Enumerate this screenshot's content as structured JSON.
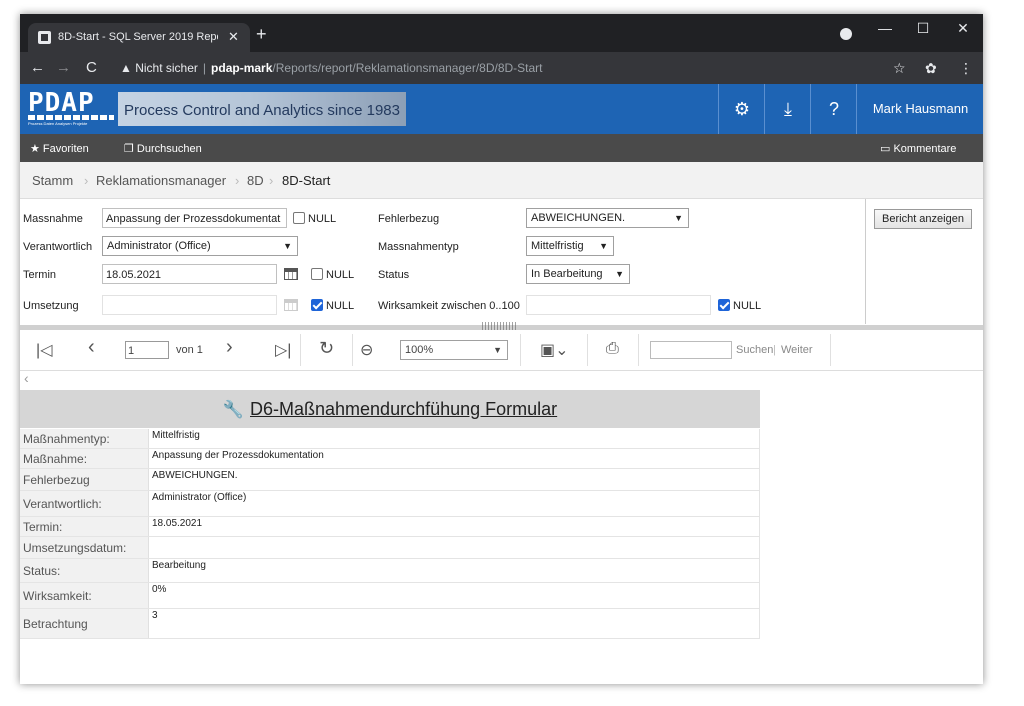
{
  "browser": {
    "tab_title": "8D-Start - SQL Server 2019 Repo",
    "tab_close": "✕",
    "new_tab": "+",
    "security_warning": "Nicht sicher",
    "url_host": "pdap-mark",
    "url_path": "/Reports/report/Reklamationsmanager/8D/8D-Start",
    "icons": {
      "back": "arrow-left-icon",
      "forward": "arrow-right-icon",
      "reload": "reload-icon",
      "star": "star-icon",
      "menu": "kebab-menu-icon"
    }
  },
  "header": {
    "logo_text": "PDAP",
    "logo_sub": "Prozess Daten Analysen Projekte",
    "banner_text": "Process Control and Analytics since 1983",
    "settings_icon": "gear-icon",
    "download_icon": "download-icon",
    "help_label": "?",
    "user_name": "Mark Hausmann",
    "brand_color": "#1e64b4"
  },
  "favbar": {
    "favorites_label": "Favoriten",
    "browse_label": "Durchsuchen",
    "comments_label": "Kommentare"
  },
  "breadcrumb": {
    "items": [
      "Stamm",
      "Reklamationsmanager",
      "8D",
      "8D-Start"
    ],
    "separator": "›"
  },
  "params": {
    "massnahme_label": "Massnahme",
    "massnahme_value": "Anpassung der Prozessdokumentat",
    "verantwortlich_label": "Verantwortlich",
    "verantwortlich_value": "Administrator (Office)",
    "termin_label": "Termin",
    "termin_value": "18.05.2021",
    "umsetzung_label": "Umsetzung",
    "umsetzung_value": "",
    "fehlerbezug_label": "Fehlerbezug",
    "fehlerbezug_value": "ABWEICHUNGEN.",
    "massnahmentyp_label": "Massnahmentyp",
    "massnahmentyp_value": "Mittelfristig",
    "status_label": "Status",
    "status_value": "In Bearbeitung",
    "wirksamkeit_label": "Wirksamkeit zwischen 0..100",
    "wirksamkeit_value": "",
    "null_label": "NULL",
    "view_report_label": "Bericht anzeigen"
  },
  "toolbar": {
    "page_current": "1",
    "page_of": "von 1",
    "zoom": "100%",
    "find_label": "Suchen",
    "next_label": "Weiter",
    "divider": "|"
  },
  "report": {
    "title": "D6-Maßnahmendurchfühung Formular",
    "rows": [
      {
        "key": "Maßnahmentyp:",
        "value": "Mittelfristig"
      },
      {
        "key": "Maßnahme:",
        "value": "Anpassung der Prozessdokumentation"
      },
      {
        "key": "Fehlerbezug",
        "value": "ABWEICHUNGEN."
      },
      {
        "key": "Verantwortlich:",
        "value": "Administrator (Office)"
      },
      {
        "key": "Termin:",
        "value": "18.05.2021"
      },
      {
        "key": "Umsetzungsdatum:",
        "value": ""
      },
      {
        "key": "Status:",
        "value": "Bearbeitung"
      },
      {
        "key": "Wirksamkeit:",
        "value": "0%"
      },
      {
        "key": "Betrachtung",
        "value": "3"
      }
    ]
  }
}
